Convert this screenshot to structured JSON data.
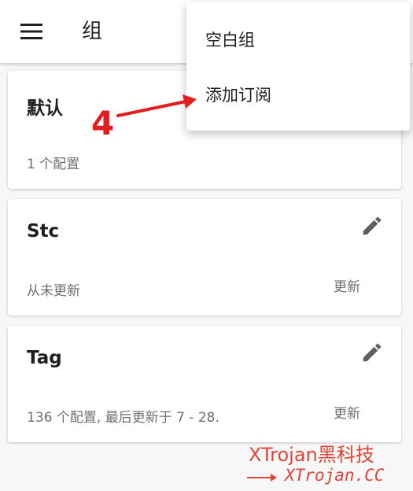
{
  "app_bar": {
    "title": "组",
    "menu_icon": "hamburger-menu-icon"
  },
  "groups": [
    {
      "title": "默认",
      "status": "1 个配置",
      "show_edit": false,
      "update_label": ""
    },
    {
      "title": "Stc",
      "status": "从未更新",
      "show_edit": true,
      "update_label": "更新"
    },
    {
      "title": "Tag",
      "status": "136 个配置, 最后更新于 7 - 28.",
      "show_edit": true,
      "update_label": "更新"
    }
  ],
  "popup_menu": {
    "items": [
      "空白组",
      "添加订阅"
    ]
  },
  "annotation": {
    "step": "4",
    "color": "#e02020"
  },
  "watermark": {
    "line1": "XTrojan黑科技",
    "line2": "XTrojan.CC",
    "color": "#e0463a"
  },
  "colors": {
    "background": "#f7f7f7",
    "surface": "#ffffff",
    "icon": "#5f5f5f",
    "secondary_text": "#6f6f6f"
  }
}
